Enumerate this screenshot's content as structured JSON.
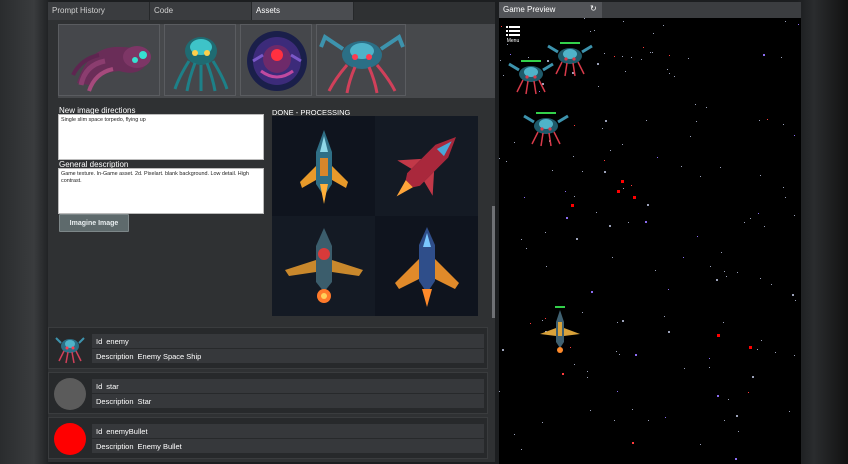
{
  "tabs": [
    {
      "label": "Prompt History",
      "active": false
    },
    {
      "label": "Code",
      "active": false
    },
    {
      "label": "Assets",
      "active": true
    }
  ],
  "form": {
    "directions_label": "New image directions",
    "directions_value": "Single slim space torpedo, flying up",
    "general_label": "General description",
    "general_value": "Game texture. In-Game asset. 2d. Pixelart. blank background. Low detail. High contrast.",
    "imagine_button": "Imagine Image"
  },
  "generation": {
    "status": "DONE - PROCESSING"
  },
  "assets": [
    {
      "id_label": "Id",
      "id": "enemy",
      "desc_label": "Description",
      "description": "Enemy Space Ship",
      "avatar": "enemy-sprite"
    },
    {
      "id_label": "Id",
      "id": "star",
      "desc_label": "Description",
      "description": "Star",
      "avatar": "#5b5b5b"
    },
    {
      "id_label": "Id",
      "id": "enemyBullet",
      "desc_label": "Description",
      "description": "Enemy Bullet",
      "avatar": "#ff0000"
    }
  ],
  "preview": {
    "tab_label": "Game Preview",
    "refresh_icon": "↻",
    "menu_label": "Menu"
  },
  "colors": {
    "enemy_body": "#1e5a6a",
    "enemy_accent": "#d83a4a",
    "player_gold": "#d9a23a",
    "health": "#33d04a",
    "bullet": "#ff0000"
  }
}
